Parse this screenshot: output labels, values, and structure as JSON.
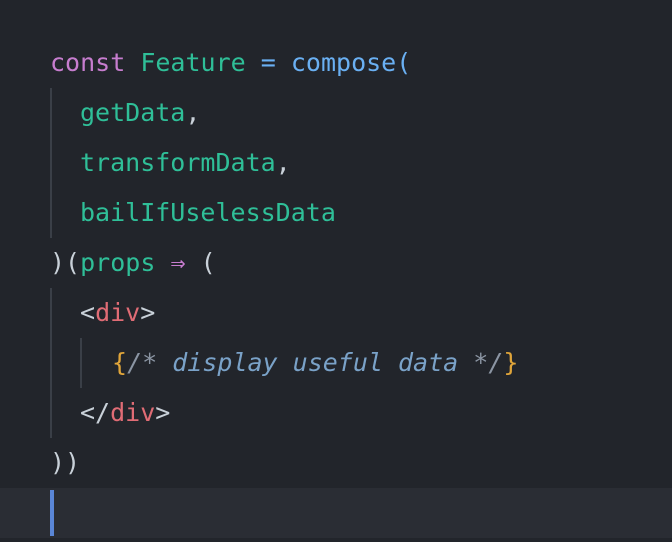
{
  "code": {
    "line1": {
      "keyword": "const",
      "name": "Feature",
      "equals": "=",
      "fn": "compose",
      "open": "("
    },
    "line2": {
      "name": "getData",
      "punct": ","
    },
    "line3": {
      "name": "transformData",
      "punct": ","
    },
    "line4": {
      "name": "bailIfUselessData"
    },
    "line5": {
      "open": ")(",
      "name": "props",
      "arrow": "⇒",
      "paren": "("
    },
    "line6": {
      "lt": "<",
      "tag": "div",
      "gt": ">"
    },
    "line7": {
      "brace_open": "{",
      "comment_open": "/*",
      "comment_text": "display useful data",
      "comment_close": "*/",
      "brace_close": "}"
    },
    "line8": {
      "lt": "</",
      "tag": "div",
      "gt": ">"
    },
    "line9": {
      "close": "))"
    }
  },
  "colors": {
    "background": "#22252b",
    "keyword": "#c77dcf",
    "identifier": "#2fbf98",
    "function": "#6ab0f3",
    "tag": "#e06c75",
    "brace": "#e0a53a",
    "comment": "#7aa2c8",
    "cursor": "#5a86d6"
  }
}
